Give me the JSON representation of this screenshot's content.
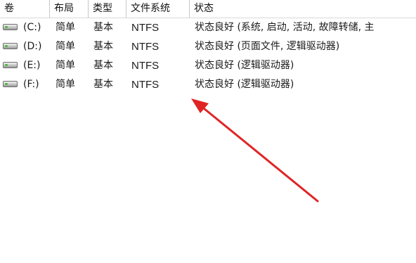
{
  "columns": {
    "volume": "卷",
    "layout": "布局",
    "type": "类型",
    "filesystem": "文件系统",
    "status": "状态"
  },
  "volumes": [
    {
      "name": "(C:)",
      "layout": "简单",
      "type": "基本",
      "filesystem": "NTFS",
      "status": "状态良好 (系统, 启动, 活动, 故障转储, 主",
      "icon": "drive-icon"
    },
    {
      "name": "(D:)",
      "layout": "简单",
      "type": "基本",
      "filesystem": "NTFS",
      "status": "状态良好 (页面文件, 逻辑驱动器)",
      "icon": "drive-icon"
    },
    {
      "name": "(E:)",
      "layout": "简单",
      "type": "基本",
      "filesystem": "NTFS",
      "status": "状态良好 (逻辑驱动器)",
      "icon": "drive-icon"
    },
    {
      "name": "(F:)",
      "layout": "简单",
      "type": "基本",
      "filesystem": "NTFS",
      "status": "状态良好 (逻辑驱动器)",
      "icon": "drive-icon"
    }
  ],
  "annotation": {
    "color": "#e02424",
    "shape": "arrow"
  }
}
